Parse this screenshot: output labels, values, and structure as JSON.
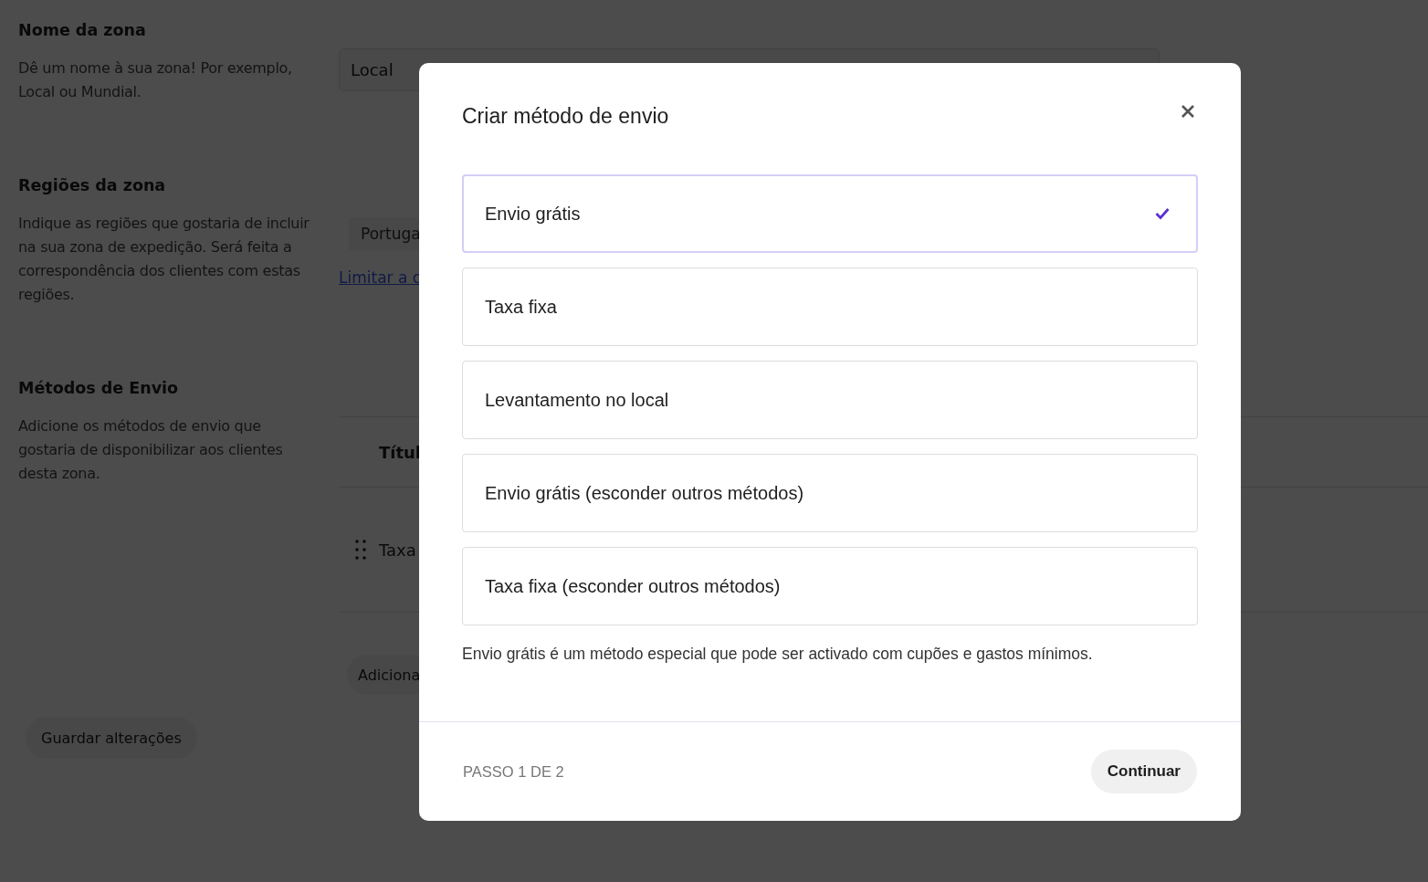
{
  "page": {
    "sections": [
      {
        "heading": "Nome da zona",
        "description": "Dê um nome à sua zona! Por exemplo, Local ou Mundial."
      },
      {
        "heading": "Regiões da zona",
        "description": "Indique as regiões que gostaria de incluir na sua zona de expedição. Será feita a correspondência dos clientes com estas regiões."
      },
      {
        "heading": "Métodos de Envio",
        "description": "Adicione os métodos de envio que gostaria de disponibilizar aos clientes desta zona."
      }
    ],
    "zone_name": {
      "value": "Local"
    },
    "region_chip": "Portuga",
    "limit_link": "Limitar a c",
    "methods_table": {
      "columns": [
        "Títul"
      ],
      "rows": [
        {
          "title": "Taxa"
        }
      ]
    },
    "add_button": "Adiciona",
    "save_button": "Guardar alterações"
  },
  "dialog": {
    "title": "Criar método de envio",
    "options": [
      {
        "label": "Envio grátis",
        "selected": true
      },
      {
        "label": "Taxa fixa",
        "selected": false
      },
      {
        "label": "Levantamento no local",
        "selected": false
      },
      {
        "label": "Envio grátis (esconder outros métodos)",
        "selected": false
      },
      {
        "label": "Taxa fixa (esconder outros métodos)",
        "selected": false
      }
    ],
    "note": "Envio grátis é um método especial que pode ser activado com cupões e gastos mínimos.",
    "step": "PASSO 1 DE 2",
    "continue_button": "Continuar"
  }
}
